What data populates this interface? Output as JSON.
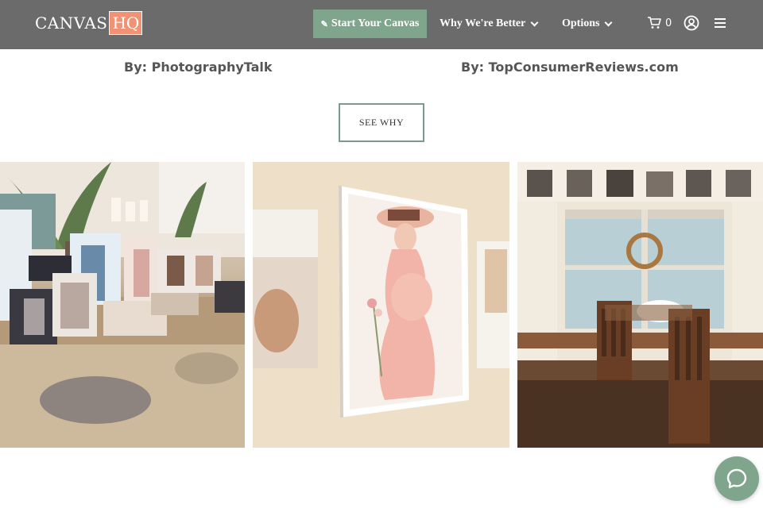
{
  "header": {
    "logo_main": "CANVAS",
    "logo_accent": "HQ",
    "cta_label": "Start Your Canvas",
    "nav": [
      {
        "label": "Why We're Better"
      },
      {
        "label": "Options"
      }
    ],
    "cart_count": "0",
    "icons": {
      "cta": "pencil-icon",
      "cart": "cart-icon",
      "account": "user-icon",
      "menu": "hamburger-menu-icon",
      "dropdown": "chevron-down-icon"
    }
  },
  "reviews": [
    {
      "by": "By: PhotographyTalk"
    },
    {
      "by": "By: TopConsumerReviews.com"
    }
  ],
  "see_why_label": "SEE WHY",
  "gallery": [
    {
      "subject": "canvas prints leaning against wall on rug"
    },
    {
      "subject": "maternity canvas print hanging on wall"
    },
    {
      "subject": "dining room with canvas prints above windows"
    }
  ],
  "chat": {
    "icon": "chat-bubble-icon"
  },
  "colors": {
    "header_bg": "#6b6b6b",
    "accent_green": "#7fa58d",
    "logo_accent_bg": "#f19274",
    "button_border": "#7c9990",
    "text_gray": "#555555"
  }
}
